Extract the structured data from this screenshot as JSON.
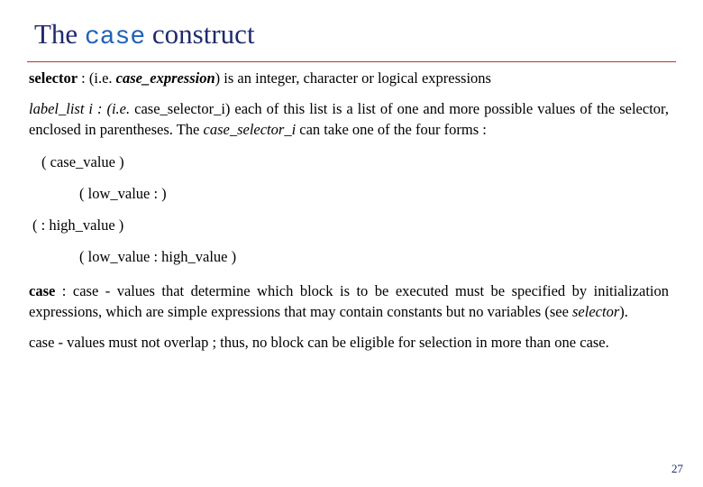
{
  "slide": {
    "title_prefix": "The ",
    "title_mono": "case",
    "title_suffix": " construct",
    "accent_rule_color": "#b9342c",
    "title_color": "#1f2b6c",
    "title_mono_color": "#1f63b8",
    "page_number": "27"
  },
  "content": {
    "selector_line": {
      "term": "selector",
      "rest_1": " : (i.e. ",
      "italic_1": "case_expression",
      "rest_2": ") is an integer, character or logical expressions"
    },
    "label_list_para": {
      "italic_lead": "label_list i : (i.e.",
      "plain_1": " case_selector_i",
      "plain_2": ") each of this list is a list of one and more possible values of the selector, enclosed in parentheses. The ",
      "italic_2": "case_selector_i",
      "plain_3": " can take one of the four forms :"
    },
    "forms": [
      "( case_value )",
      "( low_value :  )",
      "(  : high_value )",
      "( low_value : high_value )"
    ],
    "case_para": {
      "term": "case",
      "text": " :  case - values that determine which block is to be executed must be specified by initialization expressions, which are simple expressions that may contain constants but no variables (see ",
      "italic_ref": "selector",
      "tail": ")."
    },
    "overlap_para": "case - values must not overlap ; thus, no block can be eligible for selection in more than  one case."
  }
}
